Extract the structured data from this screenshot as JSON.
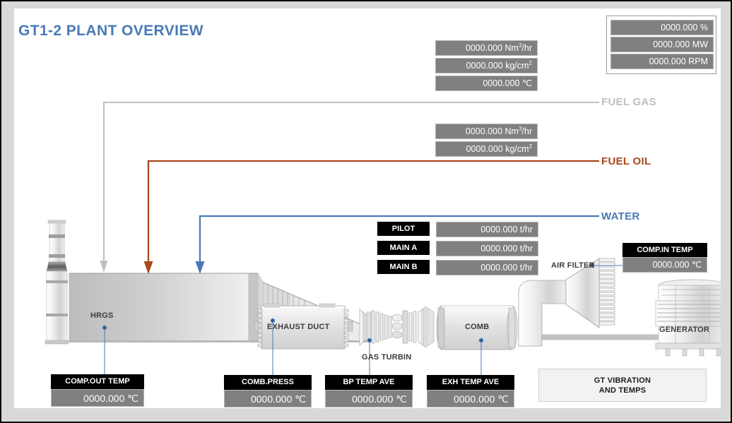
{
  "page": {
    "title": "GT1-2 PLANT OVERVIEW",
    "title_color": "#4a7ab5"
  },
  "top_right_panel": {
    "readouts": [
      {
        "value": "0000.000 %"
      },
      {
        "value": "0000.000 MW"
      },
      {
        "value": "0000.000 RPM"
      }
    ]
  },
  "fuel_gas": {
    "label": "FUEL GAS",
    "color": "#c0c0c0",
    "readouts": [
      {
        "value": "0000.000 Nm",
        "sup": "3",
        "unit": "/hr"
      },
      {
        "value": "0000.000 kg/cm",
        "sup": "2",
        "unit": ""
      },
      {
        "value": "0000.000 ℃",
        "sup": "",
        "unit": ""
      }
    ]
  },
  "fuel_oil": {
    "label": "FUEL OIL",
    "color": "#a8481a",
    "readouts": [
      {
        "value": "0000.000 Nm",
        "sup": "3",
        "unit": "/hr"
      },
      {
        "value": "0000.000 kg/cm",
        "sup": "2",
        "unit": ""
      }
    ]
  },
  "water": {
    "label": "WATER",
    "color": "#4a7ab5"
  },
  "burners": [
    {
      "label": "PILOT",
      "value": "0000.000 t/hr"
    },
    {
      "label": "MAIN A",
      "value": "0000.000 t/hr"
    },
    {
      "label": "MAIN B",
      "value": "0000.000 t/hr"
    }
  ],
  "comp_in_temp": {
    "label": "COMP.IN TEMP",
    "value": "0000.000 ℃"
  },
  "comp_out_temp": {
    "label": "COMP.OUT TEMP",
    "value": "0000.000 ℃"
  },
  "bottom_readouts": [
    {
      "label": "COMB.PRESS",
      "value": "0000.000 ℃"
    },
    {
      "label": "BP TEMP AVE",
      "value": "0000.000 ℃"
    },
    {
      "label": "EXH TEMP AVE",
      "value": "0000.000 ℃"
    }
  ],
  "vibration_button": {
    "line1": "GT VIBRATION",
    "line2": "AND TEMPS"
  },
  "equipment": [
    {
      "name": "HRGS",
      "label": "HRGS"
    },
    {
      "name": "exhaust-duct",
      "label": "EXHAUST DUCT"
    },
    {
      "name": "gas-turbine",
      "label": "GAS TURBIN"
    },
    {
      "name": "combustor",
      "label": "COMB"
    },
    {
      "name": "air-filter",
      "label": "AIR FILTER"
    },
    {
      "name": "generator",
      "label": "GENERATOR"
    }
  ]
}
